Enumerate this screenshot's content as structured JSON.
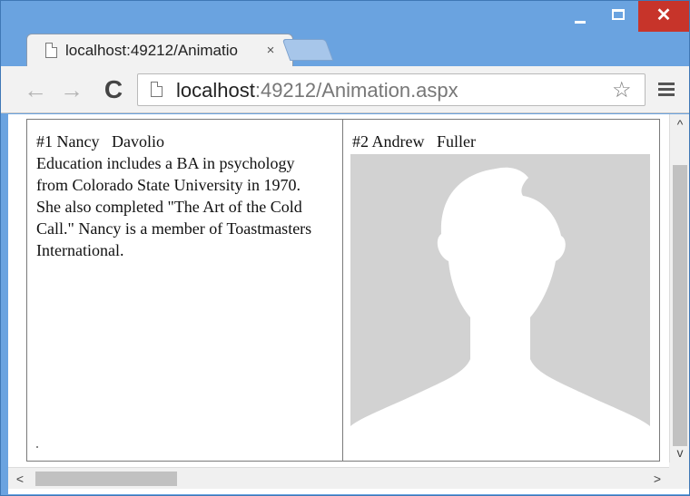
{
  "browser": {
    "tab": {
      "title": "localhost:49212/Animatio",
      "close_glyph": "×"
    },
    "address": {
      "host": "localhost",
      "rest": ":49212/Animation.aspx"
    },
    "icons": {
      "back": "back-arrow-icon",
      "forward": "forward-arrow-icon",
      "reload": "reload-icon",
      "page": "page-icon",
      "bookmark": "star-icon",
      "menu": "hamburger-menu-icon"
    },
    "glyphs": {
      "back": "←",
      "forward": "→",
      "reload": "C",
      "star": "☆",
      "minimize": "",
      "close": "✕"
    },
    "colors": {
      "titlebar": "#6aa3e0",
      "close_button": "#c7342a",
      "photo_placeholder": "#d2d2d2"
    }
  },
  "page": {
    "cards": [
      {
        "title": "#1 Nancy   Davolio",
        "notes": "Education includes a BA in psychology from Colorado State University in 1970. She also completed \"The Art of the Cold Call.\" Nancy is a member of Toastmasters International."
      },
      {
        "title": "#2 Andrew   Fuller",
        "photo": "default-avatar-silhouette"
      }
    ]
  },
  "scrollbars": {
    "vertical": {
      "up": "^",
      "down": "v"
    },
    "horizontal": {
      "left": "<",
      "right": ">"
    }
  }
}
